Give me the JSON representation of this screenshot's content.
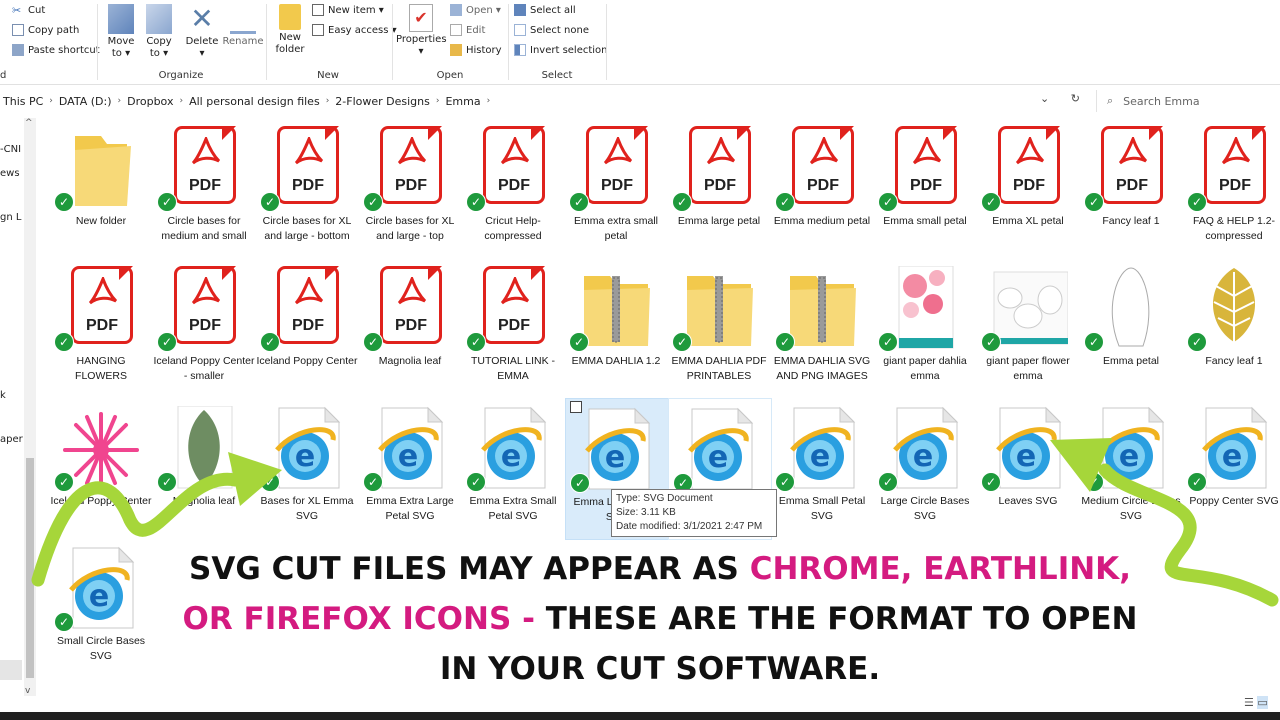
{
  "ribbon": {
    "clipboard": {
      "cut": "Cut",
      "copy_path": "Copy path",
      "paste_shortcut": "Paste shortcut"
    },
    "organize": {
      "label": "Organize",
      "move_to": "Move to ▾",
      "copy_to": "Copy to ▾",
      "delete": "Delete ▾",
      "rename": "Rename"
    },
    "new": {
      "label": "New",
      "new_folder": "New folder",
      "new_item": "New item ▾",
      "easy_access": "Easy access ▾"
    },
    "open": {
      "label": "Open",
      "properties": "Properties ▾",
      "open": "Open ▾",
      "edit": "Edit",
      "history": "History"
    },
    "select": {
      "label": "Select",
      "select_all": "Select all",
      "select_none": "Select none",
      "invert_selection": "Invert selection"
    }
  },
  "address": {
    "crumbs": [
      "This PC",
      "DATA (D:)",
      "Dropbox",
      "All personal design files",
      "2-Flower Designs",
      "Emma"
    ],
    "search_placeholder": "Search Emma"
  },
  "left_pane": [
    "-CNI",
    "ews",
    "gn L",
    "k",
    "aper"
  ],
  "files": [
    {
      "name": "New folder",
      "type": "folder"
    },
    {
      "name": "Circle bases for medium and small",
      "type": "pdf"
    },
    {
      "name": "Circle bases for XL and large - bottom",
      "type": "pdf"
    },
    {
      "name": "Circle bases for XL and large - top",
      "type": "pdf"
    },
    {
      "name": "Cricut Help-compressed",
      "type": "pdf"
    },
    {
      "name": "Emma extra small petal",
      "type": "pdf"
    },
    {
      "name": "Emma large petal",
      "type": "pdf"
    },
    {
      "name": "Emma medium petal",
      "type": "pdf"
    },
    {
      "name": "Emma small petal",
      "type": "pdf"
    },
    {
      "name": "Emma XL petal",
      "type": "pdf"
    },
    {
      "name": "Fancy leaf 1",
      "type": "pdf"
    },
    {
      "name": "FAQ & HELP 1.2-compressed",
      "type": "pdf"
    },
    {
      "name": "HANGING FLOWERS",
      "type": "pdf"
    },
    {
      "name": "Iceland Poppy Center - smaller",
      "type": "pdf"
    },
    {
      "name": "Iceland Poppy Center",
      "type": "pdf"
    },
    {
      "name": "Magnolia leaf",
      "type": "pdf"
    },
    {
      "name": "TUTORIAL LINK - EMMA",
      "type": "pdf"
    },
    {
      "name": "EMMA DAHLIA 1.2",
      "type": "zip"
    },
    {
      "name": "EMMA DAHLIA PDF PRINTABLES",
      "type": "zip"
    },
    {
      "name": "EMMA DAHLIA SVG AND PNG IMAGES",
      "type": "zip"
    },
    {
      "name": "giant paper dahlia emma",
      "type": "image-dahlia"
    },
    {
      "name": "giant paper flower emma",
      "type": "image-template"
    },
    {
      "name": "Emma petal",
      "type": "image-petal"
    },
    {
      "name": "Fancy leaf 1",
      "type": "image-leaf-gold"
    },
    {
      "name": "Iceland Poppy Center",
      "type": "image-poppy"
    },
    {
      "name": "Magnolia leaf",
      "type": "image-leaf-green"
    },
    {
      "name": "Bases for XL Emma SVG",
      "type": "svg"
    },
    {
      "name": "Emma Extra Large Petal SVG",
      "type": "svg"
    },
    {
      "name": "Emma Extra Small Petal SVG",
      "type": "svg"
    },
    {
      "name": "Emma Large Petal SVG",
      "type": "svg",
      "selected": true
    },
    {
      "name": "Emma Medium Petal SVG",
      "type": "svg",
      "hover": true
    },
    {
      "name": "Emma Small Petal SVG",
      "type": "svg"
    },
    {
      "name": "Large Circle Bases SVG",
      "type": "svg"
    },
    {
      "name": "Leaves SVG",
      "type": "svg"
    },
    {
      "name": "Medium Circle Bases SVG",
      "type": "svg"
    },
    {
      "name": "Poppy Center SVG",
      "type": "svg"
    },
    {
      "name": "Small Circle Bases SVG",
      "type": "svg"
    }
  ],
  "tooltip": {
    "type": "Type: SVG Document",
    "size": "Size: 3.11 KB",
    "modified": "Date modified: 3/1/2021 2:47 PM"
  },
  "overlay": {
    "part1": "SVG CUT FILES MAY APPEAR AS ",
    "highlight1": "CHROME, EARTHLINK,",
    "highlight2": "OR FIREFOX ICONS - ",
    "part2": "THESE ARE THE FORMAT TO OPEN",
    "part3": "IN YOUR CUT SOFTWARE."
  },
  "colors": {
    "accent_pink": "#d41b80",
    "arrow_green": "#a6d63a",
    "pdf_red": "#e0221d",
    "sync_green": "#1e9a3c"
  }
}
